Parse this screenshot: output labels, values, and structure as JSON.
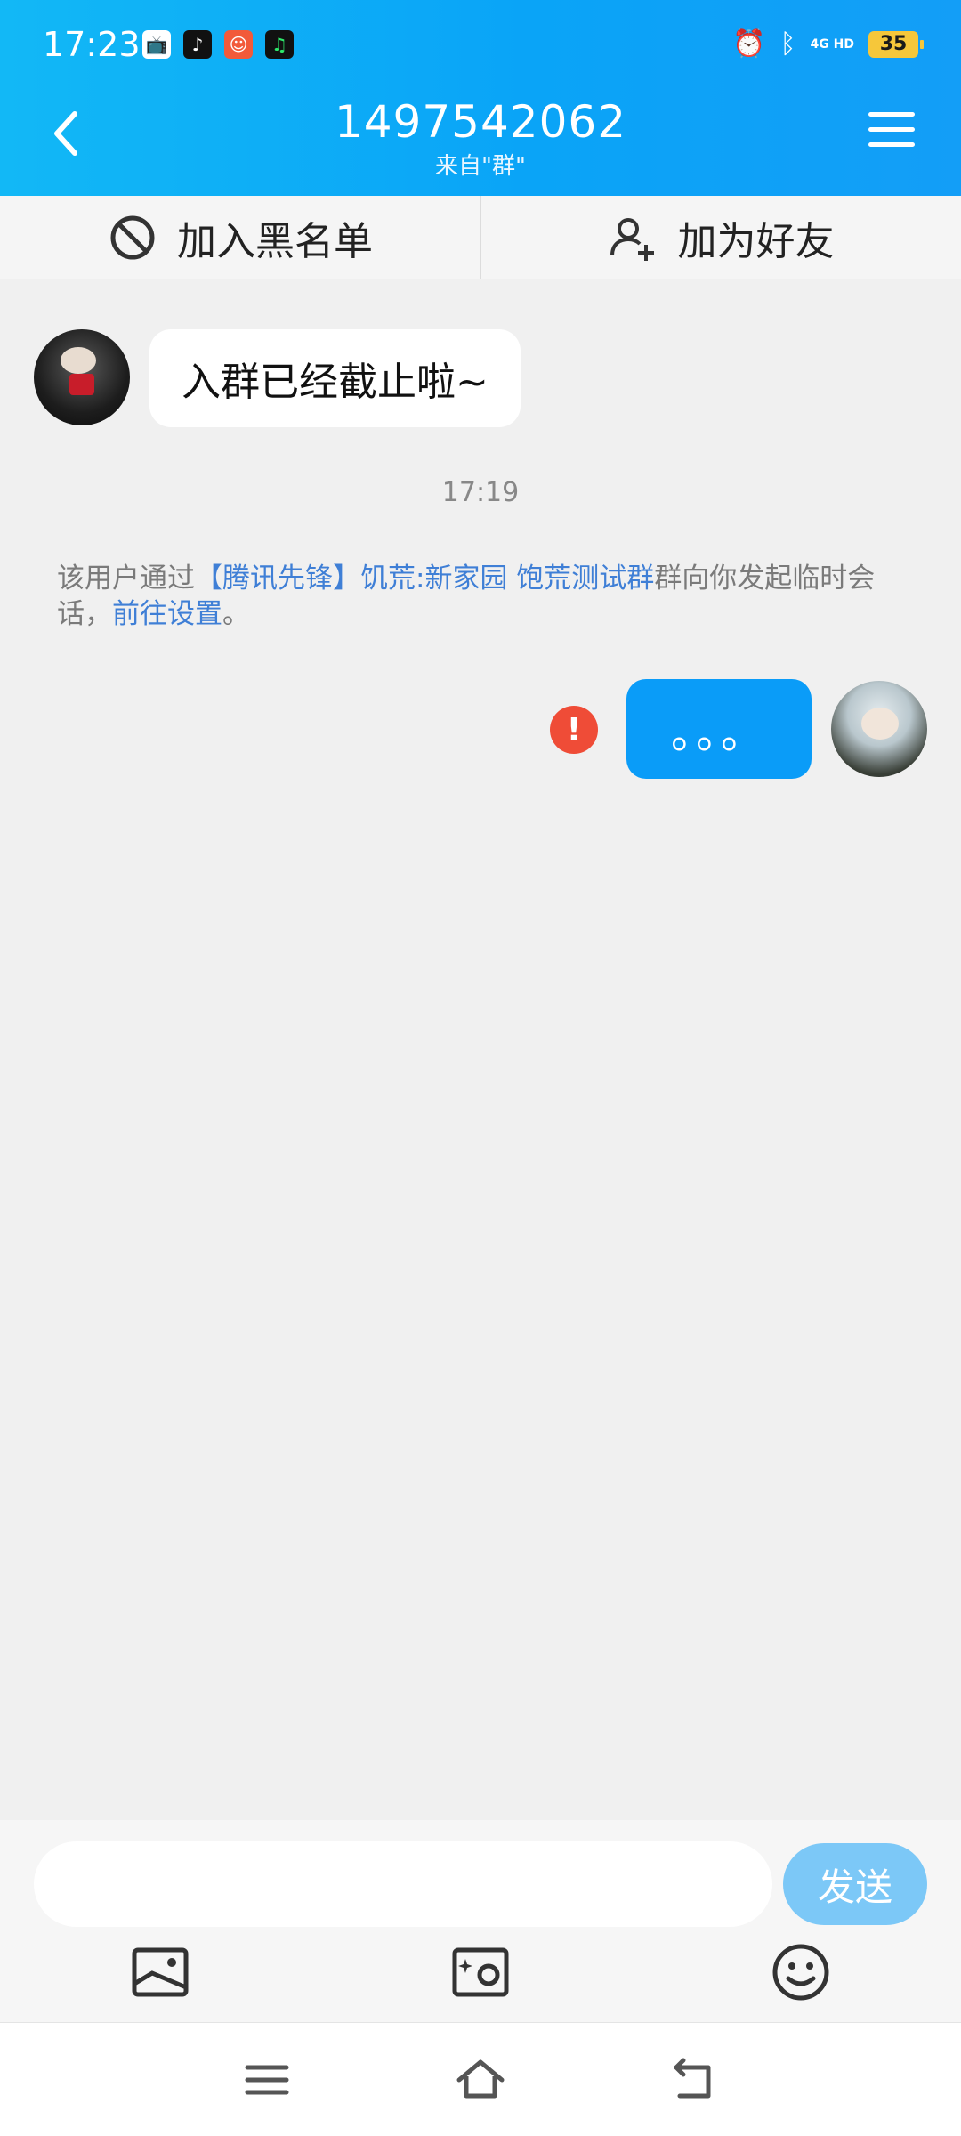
{
  "status_bar": {
    "time": "17:23",
    "network": "4G HD",
    "battery": "35",
    "app_icons": [
      "bilibili-icon",
      "tiktok-icon",
      "red-app-icon",
      "music-app-icon"
    ],
    "system_icons": [
      "alarm-icon",
      "bluetooth-icon",
      "signal-icon",
      "battery-icon"
    ]
  },
  "header": {
    "title": "1497542062",
    "subtitle": "来自\"群\""
  },
  "actions": {
    "block_label": "加入黑名单",
    "add_friend_label": "加为好友"
  },
  "messages": {
    "incoming_text": "入群已经截止啦~",
    "timestamp": "17:19",
    "system_prefix": "该用户通过",
    "system_group_link": "【腾讯先锋】饥荒:新家园 饱荒测试群",
    "system_middle": "群向你发起临时会话，",
    "system_settings_link": "前往设置",
    "system_suffix": "。",
    "outgoing_text": "。。。",
    "error_mark": "!"
  },
  "input": {
    "placeholder": "",
    "send_label": "发送"
  },
  "colors": {
    "header_blue": "#0aa4f7",
    "outgoing_bubble": "#0a9cf8",
    "link": "#3f7fd6",
    "error": "#ef4c37",
    "send_disabled": "#7cc8f7"
  }
}
